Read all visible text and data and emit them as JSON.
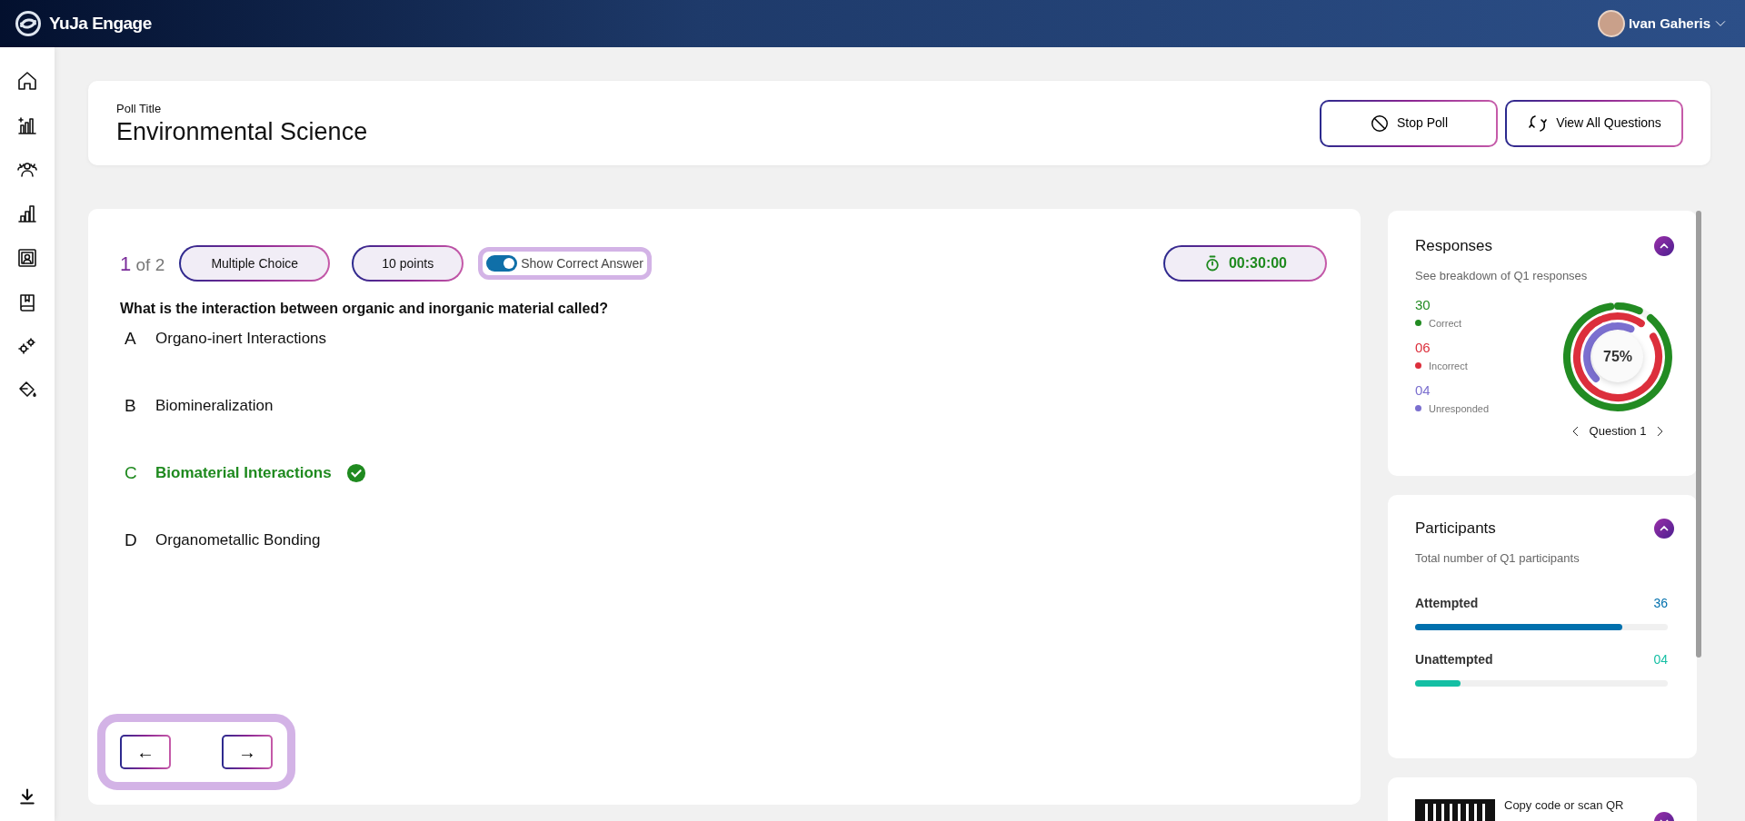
{
  "topbar": {
    "brand": "YuJa Engage",
    "user": "Ivan Gaheris"
  },
  "poll": {
    "label": "Poll Title",
    "title": "Environmental Science",
    "buttons": [
      {
        "kind": "stop",
        "label": "Stop Poll"
      },
      {
        "kind": "view",
        "label": "View All Questions"
      }
    ]
  },
  "question": {
    "index": "1",
    "of": "of 2",
    "type": "Multiple Choice",
    "points": "10 points",
    "show_correct": {
      "label": "Show Correct Answer",
      "on": true
    },
    "timer": "00:30:00",
    "text": "What is the interaction between organic and inorganic material called?",
    "options": [
      {
        "letter": "A",
        "text": "Organo-inert Interactions",
        "correct": false
      },
      {
        "letter": "B",
        "text": "Biomineralization",
        "correct": false
      },
      {
        "letter": "C",
        "text": "Biomaterial Interactions",
        "correct": true
      },
      {
        "letter": "D",
        "text": "Organometallic Bonding",
        "correct": false
      }
    ],
    "nav": [
      "←",
      "→"
    ]
  },
  "responses": {
    "title": "Responses",
    "subtitle": "See breakdown of Q1 responses",
    "stats": [
      {
        "value": "30",
        "label": "Correct",
        "color": "#228b22"
      },
      {
        "value": "06",
        "label": "Incorrect",
        "color": "#dc2f3c"
      },
      {
        "value": "04",
        "label": "Unresponded",
        "color": "#7b6fcf"
      }
    ],
    "percent": "75%",
    "question_label": "Question 1"
  },
  "participants": {
    "title": "Participants",
    "subtitle": "Total number of Q1 participants",
    "rows": [
      {
        "label": "Attempted",
        "value": "36",
        "level": 0.82,
        "color": "#0070ad"
      },
      {
        "label": "Unattempted",
        "value": "04",
        "level": 0.18,
        "color": "#14bfa4"
      }
    ]
  },
  "qr": {
    "text": "Copy code or scan QR"
  }
}
